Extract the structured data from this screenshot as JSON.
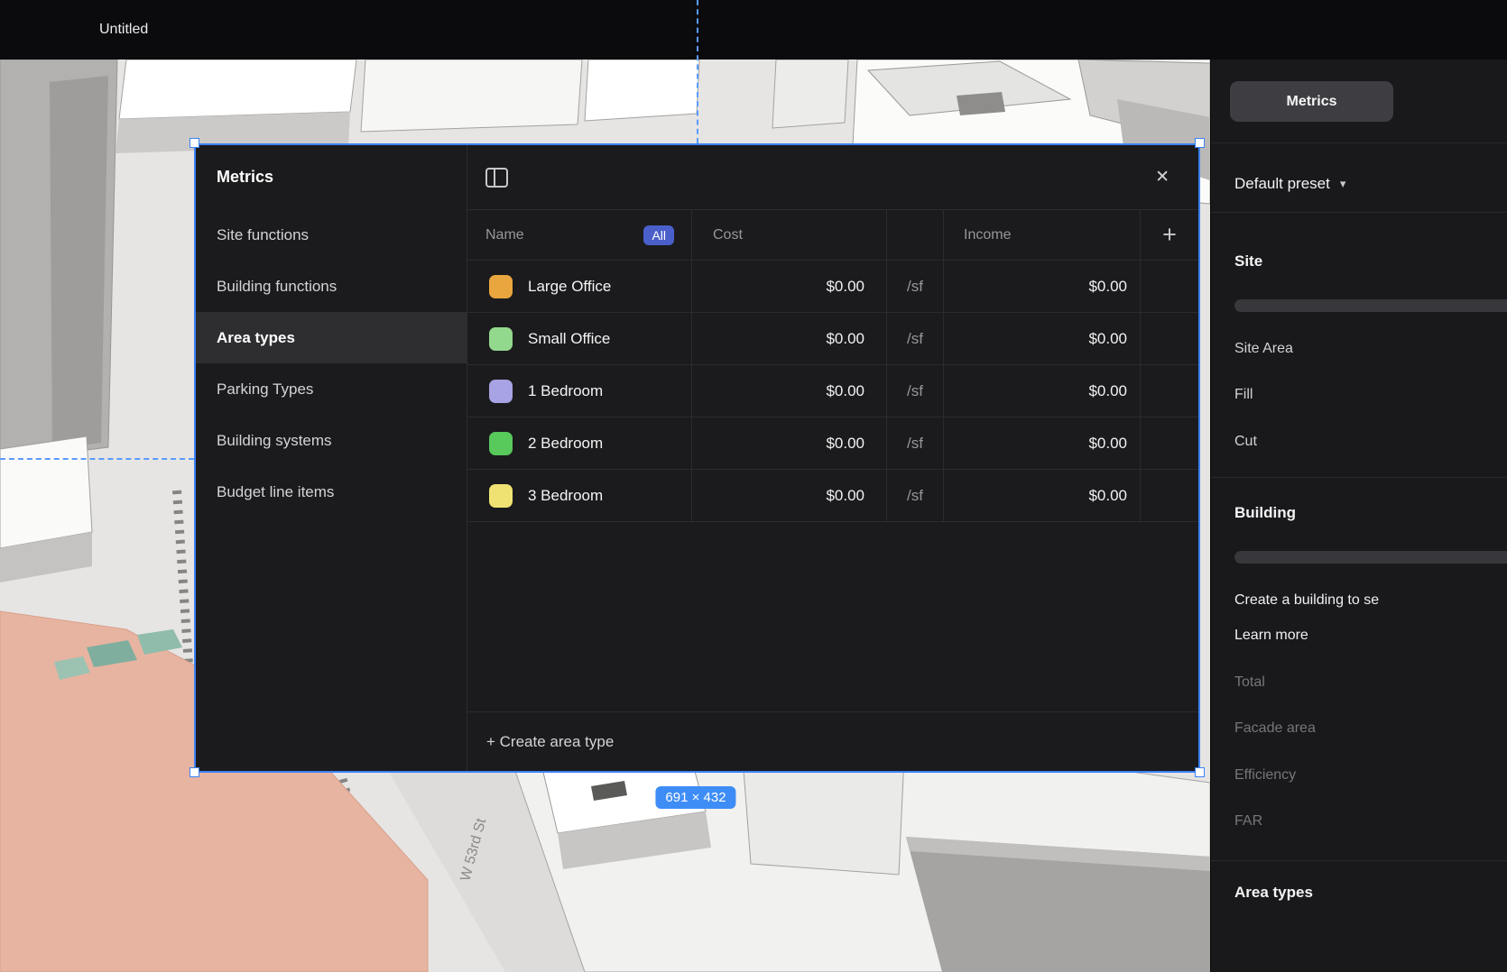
{
  "window": {
    "title": "Untitled"
  },
  "icons": {
    "close": "✕",
    "plus": "+",
    "chevron_down": "▾"
  },
  "selection": {
    "size_badge": "691 × 432"
  },
  "scene": {
    "street_label": "W 53rd St"
  },
  "modal": {
    "title": "Metrics",
    "sidebar": {
      "items": [
        {
          "label": "Site functions"
        },
        {
          "label": "Building functions"
        },
        {
          "label": "Area types"
        },
        {
          "label": "Parking Types"
        },
        {
          "label": "Building systems"
        },
        {
          "label": "Budget line items"
        }
      ]
    },
    "table": {
      "header": {
        "name": "Name",
        "name_filter": "All",
        "cost": "Cost",
        "income": "Income"
      },
      "rows": [
        {
          "name": "Large Office",
          "color": "#E9A63E",
          "cost": "$0.00",
          "unit": "/sf",
          "income": "$0.00"
        },
        {
          "name": "Small Office",
          "color": "#93D98D",
          "cost": "$0.00",
          "unit": "/sf",
          "income": "$0.00"
        },
        {
          "name": "1 Bedroom",
          "color": "#A8A3E4",
          "cost": "$0.00",
          "unit": "/sf",
          "income": "$0.00"
        },
        {
          "name": "2 Bedroom",
          "color": "#58C95B",
          "cost": "$0.00",
          "unit": "/sf",
          "income": "$0.00"
        },
        {
          "name": "3 Bedroom",
          "color": "#EFE272",
          "cost": "$0.00",
          "unit": "/sf",
          "income": "$0.00"
        }
      ],
      "footer_action": "+ Create area type"
    }
  },
  "right_panel": {
    "metrics_button": "Metrics",
    "preset": "Default preset",
    "site": {
      "title": "Site",
      "rows": [
        "Site Area",
        "Fill",
        "Cut"
      ]
    },
    "building": {
      "title": "Building",
      "empty_note": "Create a building to se",
      "learn_more": "Learn more",
      "rows": [
        "Total",
        "Facade area",
        "Efficiency",
        "FAR"
      ]
    },
    "area_types": {
      "title": "Area types"
    }
  }
}
